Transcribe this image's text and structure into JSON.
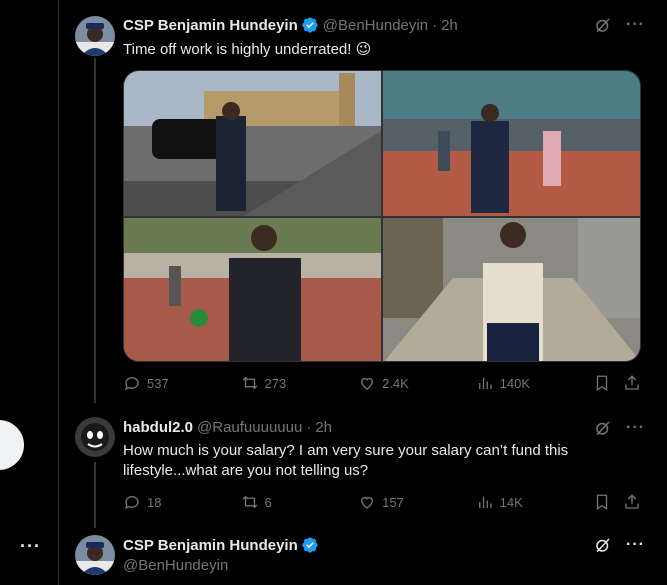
{
  "sidebar": {
    "more_label": "···"
  },
  "posts": [
    {
      "name": "CSP Benjamin Hundeyin",
      "handle": "@BenHundeyin",
      "time": "2h",
      "text": "Time off work is highly underrated! 😉",
      "stats": {
        "replies": "537",
        "reposts": "273",
        "likes": "2.4K",
        "views": "140K"
      }
    },
    {
      "name": "habdul2.0",
      "handle": "@Raufuuuuuuu",
      "time": "2h",
      "text": "How much is your salary? I am very sure your salary can’t fund this lifestyle...what are you not telling us?",
      "stats": {
        "replies": "18",
        "reposts": "6",
        "likes": "157",
        "views": "14K"
      }
    },
    {
      "name": "CSP Benjamin Hundeyin",
      "handle": "@BenHundeyin"
    }
  ],
  "colors": {
    "verified": "#1d9bf0",
    "muted": "#71767b",
    "text": "#e7e9ea"
  },
  "icons": [
    "verified-icon",
    "grok-icon",
    "more-icon",
    "reply-icon",
    "repost-icon",
    "like-icon",
    "views-icon",
    "bookmark-icon",
    "share-icon"
  ]
}
